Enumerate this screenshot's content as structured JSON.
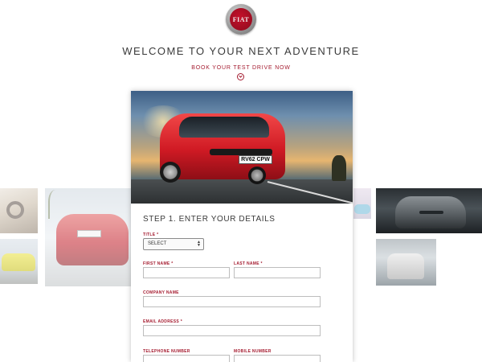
{
  "header": {
    "logo_text": "FIAT",
    "headline": "WELCOME TO YOUR NEXT ADVENTURE",
    "book_link": "BOOK YOUR TEST DRIVE NOW"
  },
  "hero": {
    "plate_text": "RV62 CPW"
  },
  "form": {
    "step_title": "STEP 1. ENTER YOUR DETAILS",
    "title_label": "TITLE *",
    "title_value": "SELECT",
    "first_name_label": "FIRST NAME *",
    "last_name_label": "LAST NAME *",
    "company_label": "COMPANY NAME",
    "email_label": "EMAIL ADDRESS *",
    "telephone_label": "TELEPHONE NUMBER",
    "mobile_label": "MOBILE NUMBER"
  },
  "colors": {
    "accent": "#a51c30",
    "hero_car": "#d01a24"
  }
}
